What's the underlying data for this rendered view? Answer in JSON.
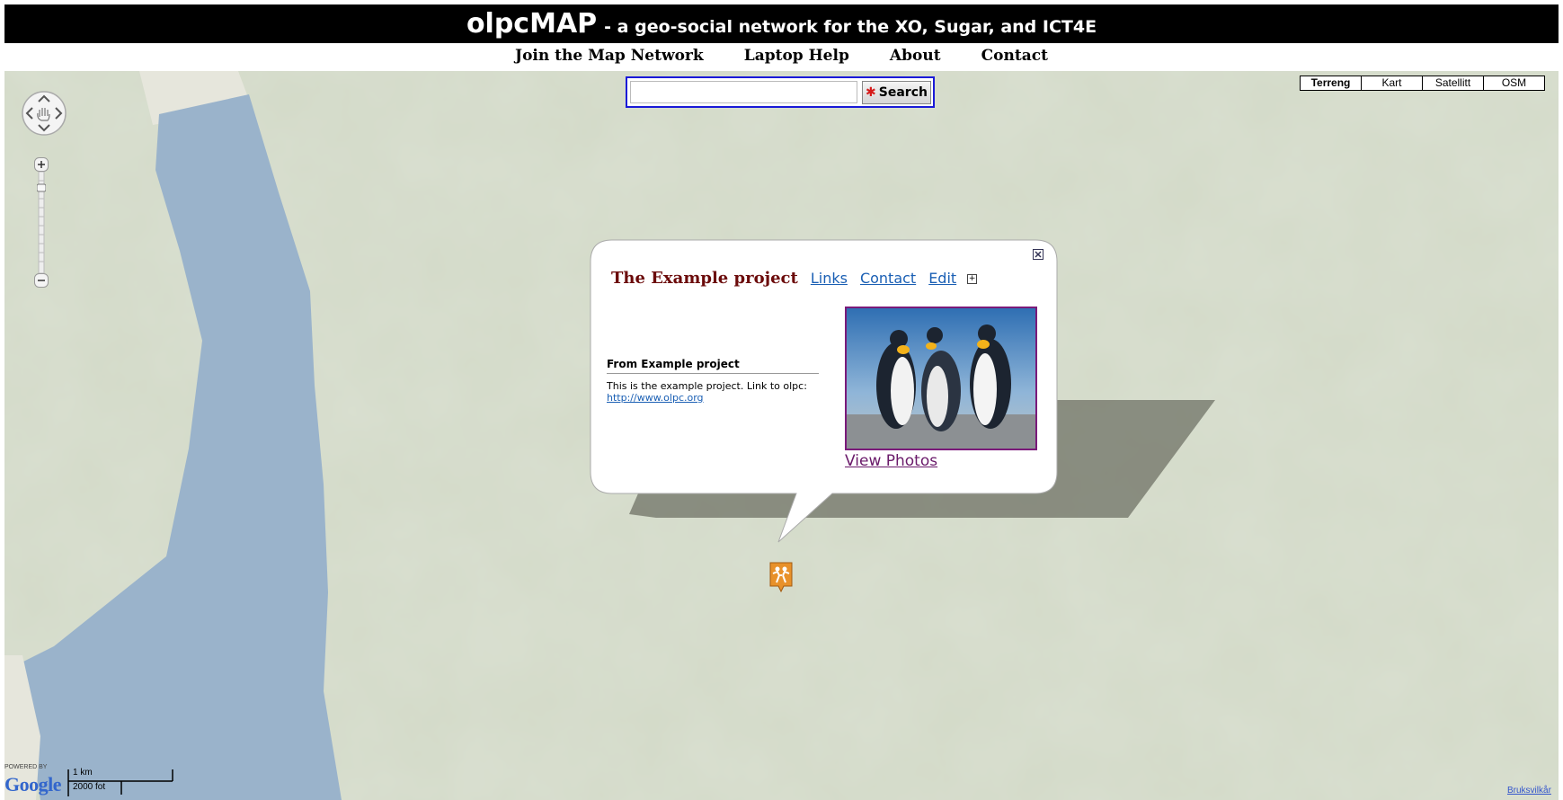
{
  "header": {
    "title": "olpcMAP",
    "tagline": "- a geo-social network for the XO, Sugar, and ICT4E"
  },
  "nav": {
    "items": [
      "Join the Map Network",
      "Laptop Help",
      "About",
      "Contact"
    ]
  },
  "search": {
    "value": "",
    "button_label": "Search",
    "button_icon": "xo-icon"
  },
  "map_types": {
    "items": [
      "Terreng",
      "Kart",
      "Satellitt",
      "OSM"
    ],
    "active": "Terreng"
  },
  "popup": {
    "title": "The Example project",
    "links": [
      "Links",
      "Contact",
      "Edit"
    ],
    "expand_symbol": "+",
    "from_heading": "From Example project",
    "description": "This is the example project. Link to olpc:",
    "description_link": "http://www.olpc.org",
    "view_photos_label": "View Photos"
  },
  "map_footer": {
    "powered_by": "POWERED BY",
    "logo_text": "Google",
    "scale_km": "1 km",
    "scale_ft": "2000 fot",
    "terms": "Bruksvilkår"
  },
  "colors": {
    "header_bg": "#000000",
    "terrain": "#d3dac8",
    "water": "#9ab3cb",
    "search_border": "#1a1ad8",
    "project_title": "#6b0a0a",
    "link": "#1a5fb4",
    "marker": "#e8912a"
  }
}
